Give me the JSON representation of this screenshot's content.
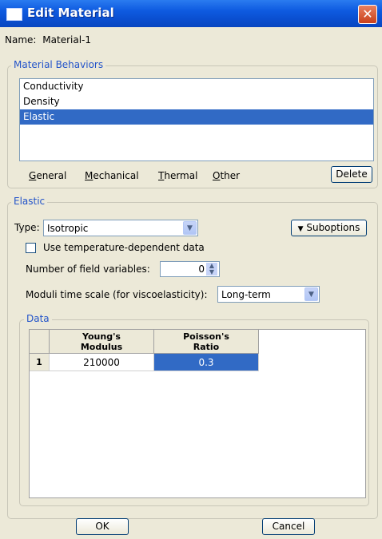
{
  "window": {
    "title": "Edit Material",
    "close_glyph": "✕"
  },
  "name_row": {
    "label": "Name:",
    "value": "Material-1"
  },
  "behaviors": {
    "group_title": "Material Behaviors",
    "items": [
      {
        "label": "Conductivity",
        "selected": false
      },
      {
        "label": "Density",
        "selected": false
      },
      {
        "label": "Elastic",
        "selected": true
      }
    ],
    "menus": [
      {
        "hotkey": "G",
        "rest": "eneral"
      },
      {
        "hotkey": "M",
        "rest": "echanical"
      },
      {
        "hotkey": "T",
        "rest": "hermal"
      },
      {
        "hotkey": "O",
        "rest": "ther"
      }
    ],
    "delete_label": "Delete"
  },
  "elastic": {
    "group_title": "Elastic",
    "type_label": "Type:",
    "type_value": "Isotropic",
    "suboptions_label": "Suboptions",
    "temp_dependent_label": "Use temperature-dependent data",
    "temp_dependent_checked": false,
    "field_vars_label": "Number of field variables:",
    "field_vars_value": "0",
    "moduli_label": "Moduli time scale (for viscoelasticity):",
    "moduli_value": "Long-term"
  },
  "data_table": {
    "group_title": "Data",
    "columns": [
      "Young's\nModulus",
      "Poisson's\nRatio"
    ],
    "rows": [
      {
        "index": "1",
        "values": [
          "210000",
          "0.3"
        ]
      }
    ]
  },
  "footer": {
    "ok_label": "OK",
    "cancel_label": "Cancel"
  },
  "colors": {
    "accent": "#316ac5",
    "title_bar": "#0a4fd0",
    "group_title": "#2253c9"
  }
}
